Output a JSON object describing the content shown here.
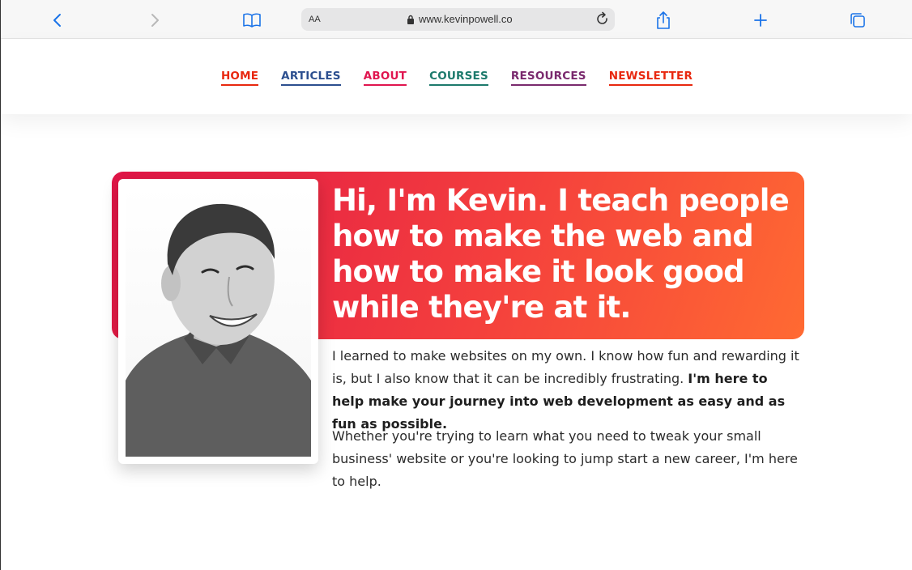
{
  "browser": {
    "text_size_label": "AA",
    "url": "www.kevinpowell.co"
  },
  "nav": [
    {
      "label": "HOME",
      "color": "#e8280f"
    },
    {
      "label": "ARTICLES",
      "color": "#2c4f8f"
    },
    {
      "label": "ABOUT",
      "color": "#e0154f"
    },
    {
      "label": "COURSES",
      "color": "#1d7a6c"
    },
    {
      "label": "RESOURCES",
      "color": "#7a2a6e"
    },
    {
      "label": "NEWSLETTER",
      "color": "#e8280f"
    }
  ],
  "hero": {
    "headline": "Hi, I'm Kevin. I teach people how to make the web and how to make it look good while they're at it.",
    "para1_plain": "I learned to make websites on my own. I know how fun and rewarding it is, but I also know that it can be incredibly frustrating. ",
    "para1_bold": "I'm here to help make your journey into web development as easy and as fun as possible.",
    "para2": "Whether you're trying to learn what you need to tweak your small business' website or you're looking to jump start a new career, I'm here to help.",
    "gradient_start": "#e01547",
    "gradient_end": "#ff6a32"
  },
  "icons": {
    "back": "chevron-left-icon",
    "forward": "chevron-right-icon",
    "bookmarks": "book-icon",
    "lock": "lock-icon",
    "reload": "reload-icon",
    "share": "share-icon",
    "new_tab": "plus-icon",
    "tabs": "tabs-icon"
  }
}
